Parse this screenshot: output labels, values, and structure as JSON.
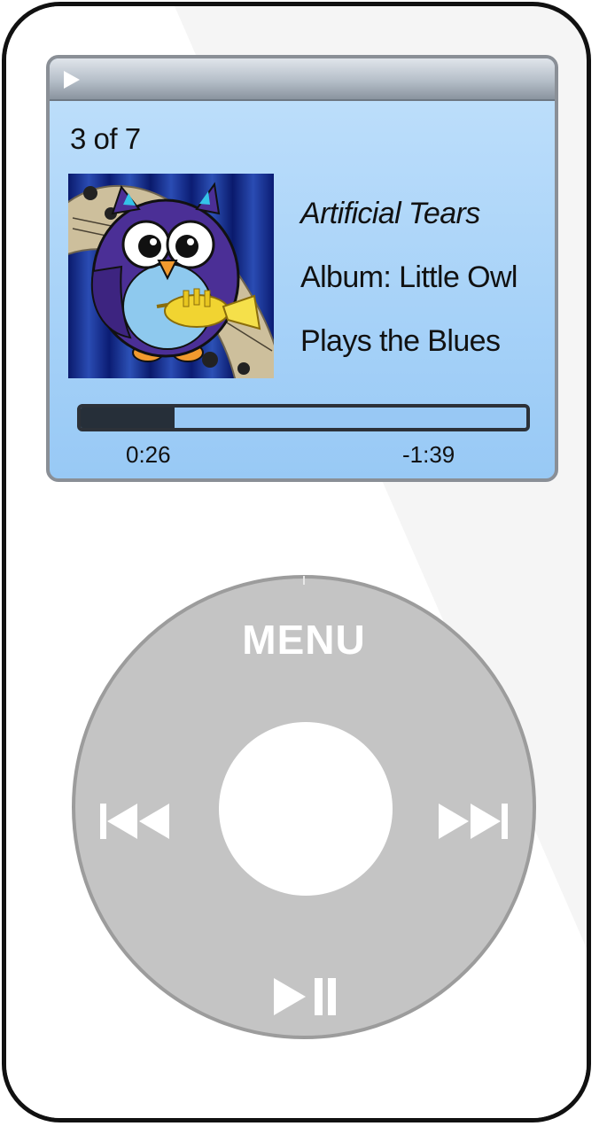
{
  "screen": {
    "track_count": "3 of 7",
    "song_title": "Artificial Tears",
    "album_line_1": "Album: Little Owl",
    "album_line_2": "Plays the Blues",
    "elapsed": "0:26",
    "remaining": "-1:39",
    "progress_fraction": 0.21
  },
  "wheel": {
    "menu_label": "MENU"
  },
  "icons": {
    "status": "play-icon",
    "previous": "rewind-icon",
    "next": "fast-forward-icon",
    "play_pause": "play-pause-icon",
    "album_art": "owl-playing-trumpet-illustration"
  },
  "colors": {
    "screen_background": "#a7d2f8",
    "progress_fill": "#262f39",
    "wheel": "#c4c4c4",
    "body_outline": "#111111"
  }
}
